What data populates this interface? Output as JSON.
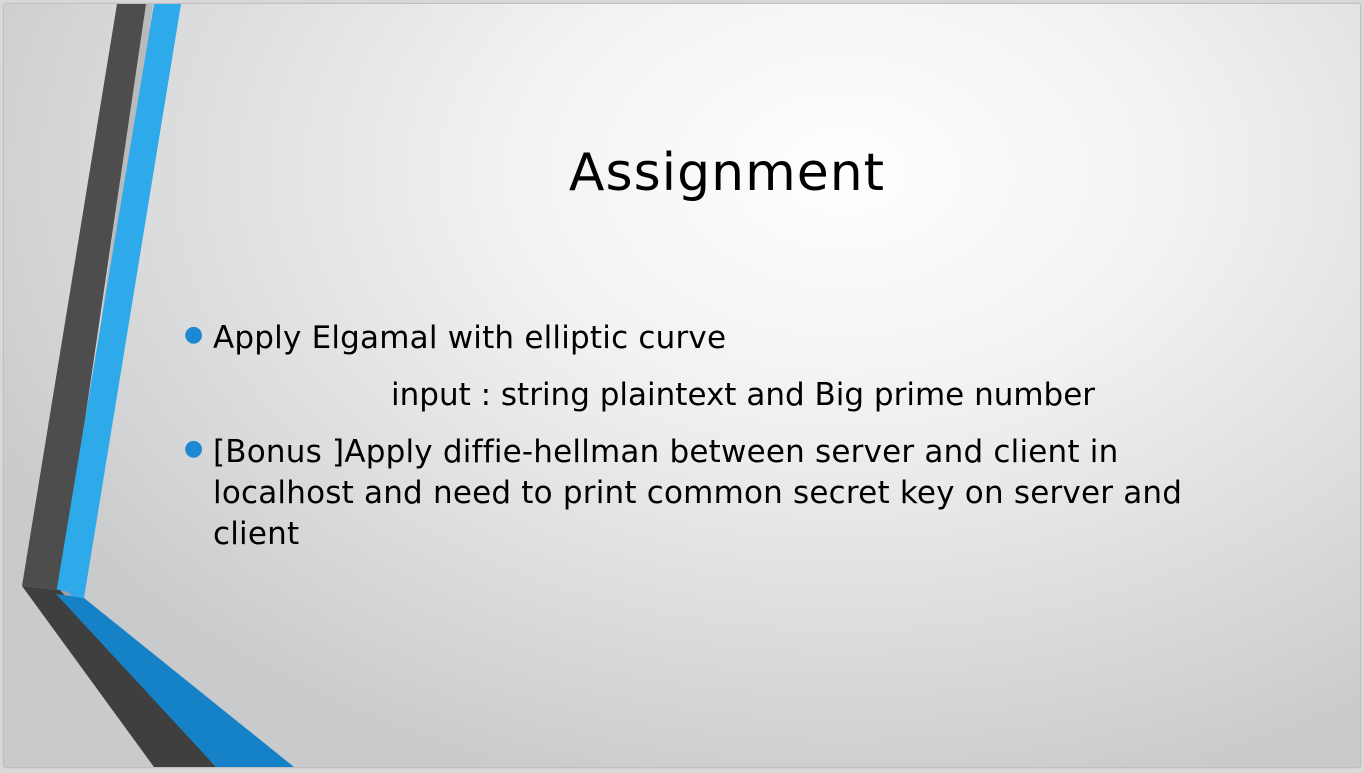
{
  "slide": {
    "title": "Assignment",
    "bullets": [
      {
        "text": "Apply Elgamal with elliptic curve",
        "icon": "bullet-dot"
      },
      {
        "text": "[Bonus ]Apply diffie-hellman between server and client in localhost  and need to print common secret key on server and client",
        "icon": "bullet-dot"
      }
    ],
    "sub_text": "input : string plaintext and Big prime number",
    "colors": {
      "accent_blue": "#2ea9ea",
      "dark_blue": "#157fc4",
      "dark_gray": "#4b4b4b",
      "bullet": "#1e88d2"
    }
  }
}
